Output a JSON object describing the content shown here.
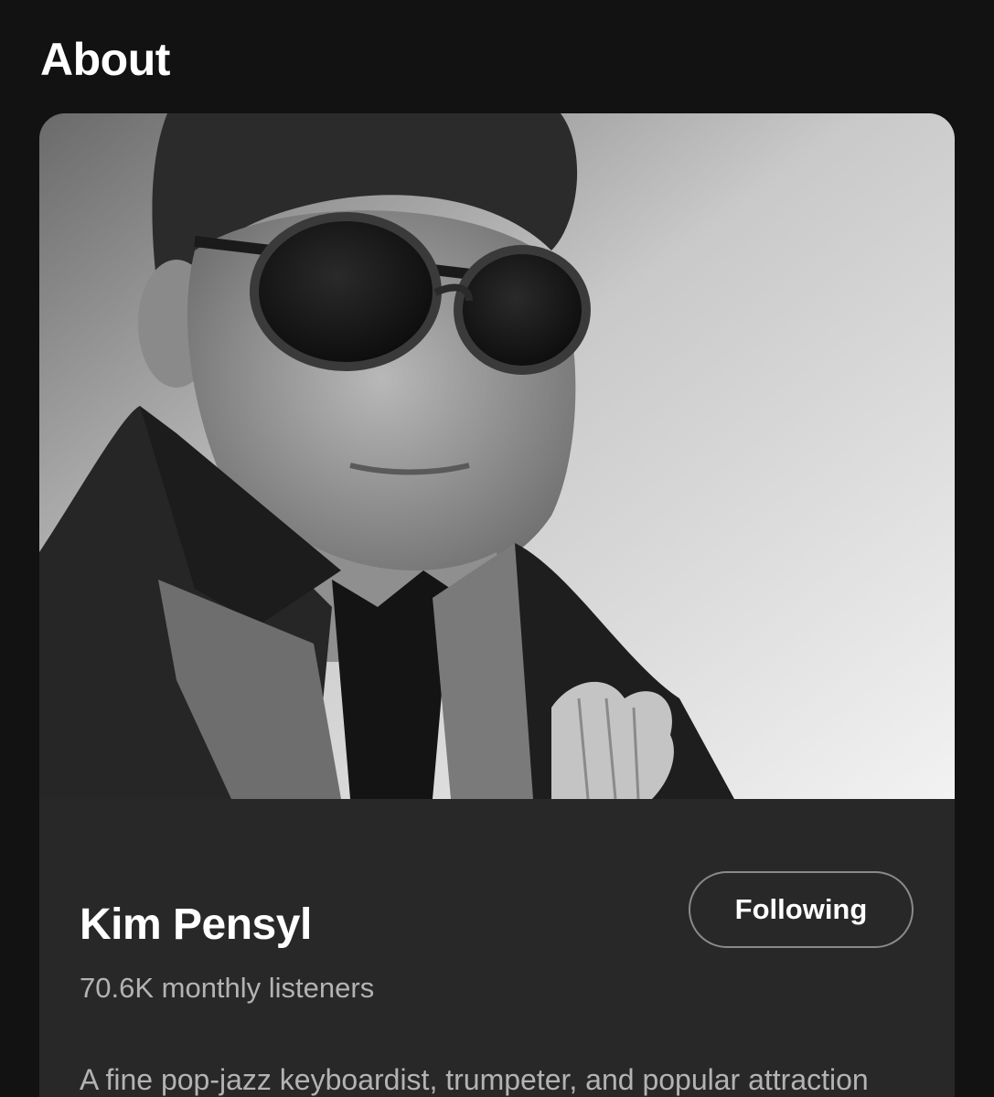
{
  "section": {
    "title": "About"
  },
  "artist": {
    "name": "Kim Pensyl",
    "monthly_listeners": "70.6K monthly listeners",
    "follow_button_label": "Following",
    "bio": "A fine pop-jazz keyboardist, trumpeter, and popular attraction on the \"contemporary jazz\" circuit, Kim Pensyl"
  },
  "colors": {
    "background": "#121212",
    "card": "#282828",
    "text_primary": "#ffffff",
    "text_secondary": "#b3b3b3",
    "button_border": "#8a8a8a"
  }
}
